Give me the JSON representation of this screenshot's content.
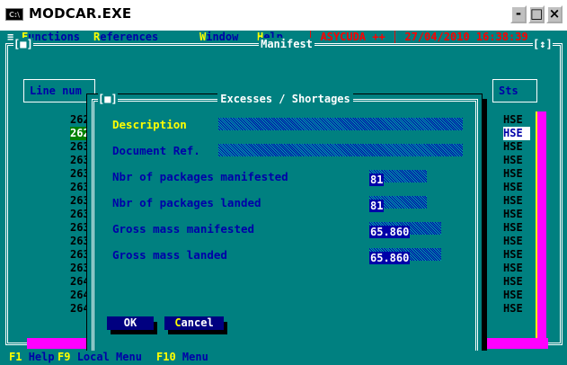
{
  "window": {
    "title": "MODCAR.EXE",
    "icon_label": "C:\\",
    "controls": {
      "minimize": "-",
      "maximize": "□",
      "close": "×"
    }
  },
  "menubar": {
    "system": "≡",
    "items": [
      {
        "hotkey": "F",
        "rest": "unctions"
      },
      {
        "hotkey": "R",
        "rest": "eferences"
      },
      {
        "hotkey": "W",
        "rest": "indow"
      },
      {
        "hotkey": "H",
        "rest": "elp"
      }
    ],
    "status": "│ ASYCUDA ++ │ 27/04/2010 16:38:39"
  },
  "manifest": {
    "title": "Manifest",
    "close_ctl": "[■]",
    "zoom_ctl": "[↕]",
    "column_header": "Line num",
    "status_header": "Sts",
    "rows": [
      {
        "line": "2628/",
        "status": "HSE"
      },
      {
        "line": "2629/",
        "status": "HSE"
      },
      {
        "line": "2630/",
        "status": "HSE"
      },
      {
        "line": "2631/",
        "status": "HSE"
      },
      {
        "line": "2632/",
        "status": "HSE"
      },
      {
        "line": "2633/",
        "status": "HSE"
      },
      {
        "line": "2634/",
        "status": "HSE"
      },
      {
        "line": "2635/",
        "status": "HSE"
      },
      {
        "line": "2636/",
        "status": "HSE"
      },
      {
        "line": "2637/",
        "status": "HSE"
      },
      {
        "line": "2638/",
        "status": "HSE"
      },
      {
        "line": "2639/",
        "status": "HSE"
      },
      {
        "line": "2640/",
        "status": "HSE"
      },
      {
        "line": "2641/",
        "status": "HSE"
      },
      {
        "line": "2642/",
        "status": "HSE"
      }
    ],
    "selected_index": 1
  },
  "dialog": {
    "title": "Excesses / Shortages",
    "close_ctl": "[■]",
    "fields": {
      "description_label": "Description",
      "document_ref_label": "Document Ref.",
      "pkgs_manifested_label": "Nbr of packages manifested",
      "pkgs_manifested_value": "81",
      "pkgs_landed_label": "Nbr of packages landed",
      "pkgs_landed_value": "81",
      "gross_manifested_label": "Gross mass manifested",
      "gross_manifested_value": "65.860",
      "gross_landed_label": "Gross mass landed",
      "gross_landed_value": "65.860"
    },
    "ok": "OK",
    "cancel": {
      "hotkey": "C",
      "rest": "ancel"
    }
  },
  "footer": {
    "keys": [
      {
        "key": "F1",
        "desc": "Help"
      },
      {
        "key": "F9",
        "desc": "Local Menu"
      },
      {
        "key": "F10",
        "desc": "Menu"
      }
    ]
  },
  "colors": {
    "background": "#008080",
    "label": "#0000a8",
    "hotkey": "#ffff00",
    "selection": "#008000",
    "scrollbar": "#ff00ff"
  }
}
